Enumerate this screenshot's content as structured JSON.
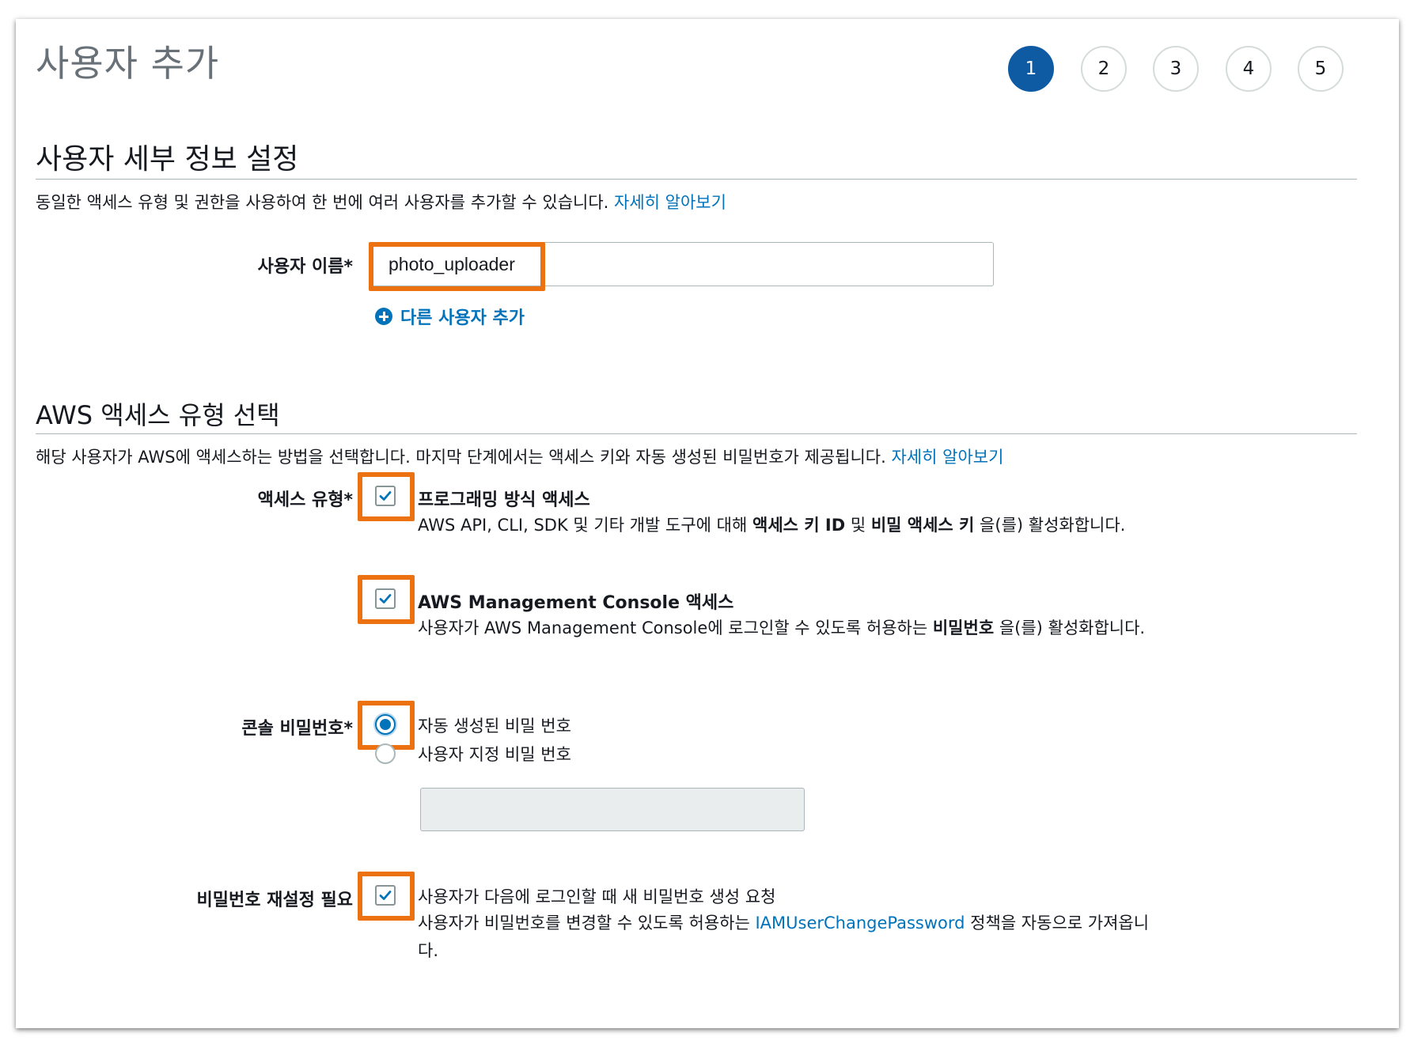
{
  "page": {
    "title": "사용자 추가",
    "steps": [
      "1",
      "2",
      "3",
      "4",
      "5"
    ],
    "active_step": 1
  },
  "user_details": {
    "heading": "사용자 세부 정보 설정",
    "description": "동일한 액세스 유형 및 권한을 사용하여 한 번에 여러 사용자를 추가할 수 있습니다.",
    "learn_more": "자세히 알아보기",
    "username_label": "사용자 이름*",
    "username_value": "photo_uploader",
    "add_another_user": "다른 사용자 추가"
  },
  "access_type": {
    "heading": "AWS 액세스 유형 선택",
    "description": "해당 사용자가 AWS에 액세스하는 방법을 선택합니다. 마지막 단계에서는 액세스 키와 자동 생성된 비밀번호가 제공됩니다.",
    "learn_more": "자세히 알아보기",
    "label": "액세스 유형*",
    "programmatic": {
      "checked": true,
      "title": "프로그래밍 방식 액세스",
      "text_1": "AWS API, CLI, SDK 및 기타 개발 도구에 대해 ",
      "bold_1": "액세스 키 ID",
      "text_2": " 및 ",
      "bold_2": "비밀 액세스 키",
      "text_3": " 을(를) 활성화합니다."
    },
    "console": {
      "checked": true,
      "title": "AWS Management Console 액세스",
      "text_1": "사용자가 AWS Management Console에 로그인할 수 있도록 허용하는 ",
      "bold_1": "비밀번호",
      "text_2": " 을(를) 활성화합니다."
    }
  },
  "console_password": {
    "label": "콘솔 비밀번호*",
    "selected": "autogenerated",
    "option_auto": "자동 생성된 비밀 번호",
    "option_custom": "사용자 지정 비밀 번호",
    "custom_value": ""
  },
  "reset_required": {
    "label": "비밀번호 재설정 필요",
    "checked": true,
    "text": "사용자가 다음에 로그인할 때 새 비밀번호 생성 요청",
    "text_2a": "사용자가 비밀번호를 변경할 수 있도록 허용하는 ",
    "policy_link": "IAMUserChangePassword",
    "text_2b": " 정책을 자동으로 가져옵니다."
  },
  "colors": {
    "accent": "#0073bb",
    "step_active": "#0e5ba3",
    "highlight": "#ec7211"
  }
}
